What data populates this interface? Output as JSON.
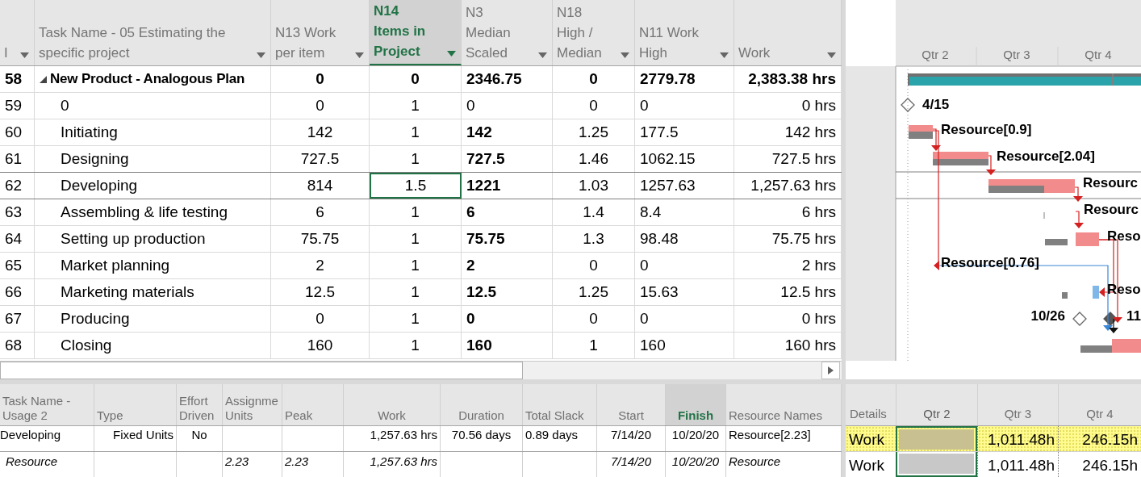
{
  "table": {
    "columns": [
      {
        "label": "I",
        "selected": false
      },
      {
        "label": "Task Name - 05 Estimating the specific project",
        "selected": false
      },
      {
        "label": "N13 Work per item",
        "selected": false
      },
      {
        "label": "N14 Items in Project",
        "selected": true
      },
      {
        "label": "N3 Median Scaled",
        "selected": false
      },
      {
        "label": "N18 High / Median",
        "selected": false
      },
      {
        "label": "N11 Work High",
        "selected": false
      },
      {
        "label": "Work",
        "selected": false
      }
    ],
    "rows": [
      {
        "expanded": true,
        "selected": false,
        "cells": [
          "58",
          "New Product - Analogous Plan",
          "0",
          "0",
          "2346.75",
          "0",
          "2779.78",
          "2,383.38 hrs"
        ],
        "children": [
          {
            "selected": false,
            "n3_bold": false,
            "cells": [
              "59",
              "0",
              "0",
              "1",
              "0",
              "0",
              "0",
              "0 hrs"
            ]
          },
          {
            "selected": false,
            "n3_bold": true,
            "cells": [
              "60",
              "Initiating",
              "142",
              "1",
              "142",
              "1.25",
              "177.5",
              "142 hrs"
            ]
          },
          {
            "selected": false,
            "n3_bold": true,
            "cells": [
              "61",
              "Designing",
              "727.5",
              "1",
              "727.5",
              "1.46",
              "1062.15",
              "727.5 hrs"
            ]
          },
          {
            "selected": true,
            "n3_bold": true,
            "cells": [
              "62",
              "Developing",
              "814",
              "1.5",
              "1221",
              "1.03",
              "1257.63",
              "1,257.63 hrs"
            ]
          },
          {
            "selected": false,
            "n3_bold": true,
            "cells": [
              "63",
              "Assembling & life testing",
              "6",
              "1",
              "6",
              "1.4",
              "8.4",
              "6 hrs"
            ]
          },
          {
            "selected": false,
            "n3_bold": true,
            "cells": [
              "64",
              "Setting up production",
              "75.75",
              "1",
              "75.75",
              "1.3",
              "98.48",
              "75.75 hrs"
            ]
          },
          {
            "selected": false,
            "n3_bold": true,
            "cells": [
              "65",
              "Market planning",
              "2",
              "1",
              "2",
              "0",
              "0",
              "2 hrs"
            ]
          },
          {
            "selected": false,
            "n3_bold": true,
            "cells": [
              "66",
              "Marketing materials",
              "12.5",
              "1",
              "12.5",
              "1.25",
              "15.63",
              "12.5 hrs"
            ]
          },
          {
            "selected": false,
            "n3_bold": true,
            "cells": [
              "67",
              "Producing",
              "0",
              "1",
              "0",
              "0",
              "0",
              "0 hrs"
            ]
          },
          {
            "selected": false,
            "n3_bold": true,
            "cells": [
              "68",
              "Closing",
              "160",
              "1",
              "160",
              "1",
              "160",
              "160 hrs"
            ]
          }
        ]
      }
    ]
  },
  "gantt": {
    "timescale": [
      "Qtr 2",
      "Qtr 3",
      "Qtr 4"
    ],
    "bar_labels": [
      {
        "text": "4/15"
      },
      {
        "text": "Resource[0.9]"
      },
      {
        "text": "Resource[2.04]"
      },
      {
        "text": "Resourc"
      },
      {
        "text": "Resourc"
      },
      {
        "text": "Reso"
      },
      {
        "text": "Resource[0.76]"
      },
      {
        "text": "Reso"
      },
      {
        "text": "10/26"
      },
      {
        "text": "11"
      }
    ]
  },
  "usage": {
    "columns": [
      {
        "label": "Task Name - Usage 2",
        "selected": false
      },
      {
        "label": "Type",
        "selected": false
      },
      {
        "label": "Effort Driven",
        "selected": false
      },
      {
        "label": "Assignme Units",
        "selected": false
      },
      {
        "label": "Peak",
        "selected": false
      },
      {
        "label": "Work",
        "selected": false
      },
      {
        "label": "Duration",
        "selected": false
      },
      {
        "label": "Total Slack",
        "selected": false
      },
      {
        "label": "Start",
        "selected": false
      },
      {
        "label": "Finish",
        "selected": true
      },
      {
        "label": "Resource Names",
        "selected": false
      }
    ],
    "rows": [
      {
        "kind": "task",
        "cells": [
          "Developing",
          "Fixed Units",
          "No",
          null,
          null,
          "1,257.63 hrs",
          "70.56 days",
          "0.89 days",
          "7/14/20",
          "10/20/20",
          "Resource[2.23]"
        ]
      },
      {
        "kind": "assignment",
        "cells": [
          "Resource",
          null,
          null,
          "2.23",
          "2.23",
          "1,257.63 hrs",
          null,
          null,
          "7/14/20",
          "10/20/20",
          "Resource"
        ]
      }
    ]
  },
  "timephased": {
    "details_label": "Details",
    "columns": [
      {
        "label": "Qtr 2",
        "selected": true
      },
      {
        "label": "Qtr 3",
        "selected": false
      },
      {
        "label": "Qtr 4",
        "selected": false
      }
    ],
    "rows": [
      {
        "label": "Work",
        "highlighted": true,
        "cells": [
          null,
          "1,011.48h",
          "246.15h"
        ]
      },
      {
        "label": "Work",
        "highlighted": false,
        "cells": [
          null,
          "1,011.48h",
          "246.15h"
        ]
      }
    ]
  }
}
